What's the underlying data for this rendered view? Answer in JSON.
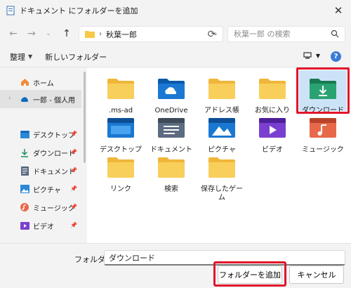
{
  "window": {
    "title": "ドキュメント にフォルダーを追加"
  },
  "nav": {
    "address_segment": "秋葉一郎",
    "search_placeholder": "秋葉一郎 の検索"
  },
  "toolbar": {
    "organize_label": "整理",
    "new_folder_label": "新しいフォルダー"
  },
  "sidebar": {
    "items": [
      {
        "label": "ホーム",
        "icon": "home-icon"
      },
      {
        "label": "一郎 - 個人用",
        "icon": "onedrive-icon"
      },
      {
        "label": "デスクトップ",
        "icon": "desktop-icon"
      },
      {
        "label": "ダウンロード",
        "icon": "download-icon"
      },
      {
        "label": "ドキュメント",
        "icon": "document-icon"
      },
      {
        "label": "ピクチャ",
        "icon": "pictures-icon"
      },
      {
        "label": "ミュージック",
        "icon": "music-icon"
      },
      {
        "label": "ビデオ",
        "icon": "video-icon"
      }
    ]
  },
  "folders": [
    {
      "label": ".ms-ad",
      "icon": "folder-icon"
    },
    {
      "label": "OneDrive",
      "icon": "onedrive-folder-icon"
    },
    {
      "label": "アドレス帳",
      "icon": "folder-icon"
    },
    {
      "label": "お気に入り",
      "icon": "folder-icon"
    },
    {
      "label": "ダウンロード",
      "icon": "download-folder-icon"
    },
    {
      "label": "デスクトップ",
      "icon": "desktop-folder-icon"
    },
    {
      "label": "ドキュメント",
      "icon": "document-folder-icon"
    },
    {
      "label": "ピクチャ",
      "icon": "pictures-folder-icon"
    },
    {
      "label": "ビデオ",
      "icon": "video-folder-icon"
    },
    {
      "label": "ミュージック",
      "icon": "music-folder-icon"
    },
    {
      "label": "リンク",
      "icon": "folder-icon"
    },
    {
      "label": "検索",
      "icon": "folder-icon"
    },
    {
      "label": "保存したゲーム",
      "icon": "folder-icon"
    }
  ],
  "footer": {
    "folder_label": "フォルダー:",
    "folder_value": "ダウンロード",
    "add_button": "フォルダーを追加",
    "cancel_button": "キャンセル"
  },
  "colors": {
    "highlight_red": "#e2152b",
    "folder_yellow": "#f7c948",
    "accent_blue": "#0f6cbd"
  }
}
